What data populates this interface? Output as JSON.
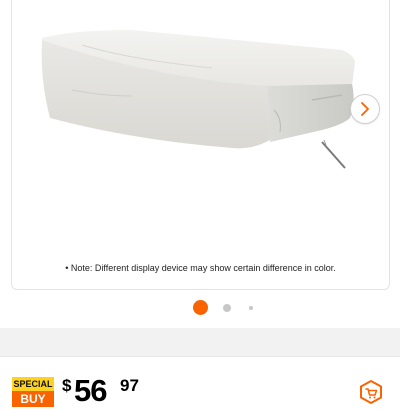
{
  "product_gallery": {
    "image_alt": "Light gray outdoor chaise lounge cover",
    "note": "• Note: Different display device may show certain difference in color.",
    "next_button_label": "Next image",
    "dot_count": 3,
    "active_dot": 1
  },
  "pricing": {
    "badge": {
      "line1": "SPECIAL",
      "line2": "BUY"
    },
    "currency": "$",
    "dollars": "56",
    "cents": "97"
  },
  "icons": {
    "next": "chevron-right-icon",
    "cart": "cart-icon"
  },
  "colors": {
    "accent": "#f96302",
    "badge_yellow": "#ffd21f"
  }
}
